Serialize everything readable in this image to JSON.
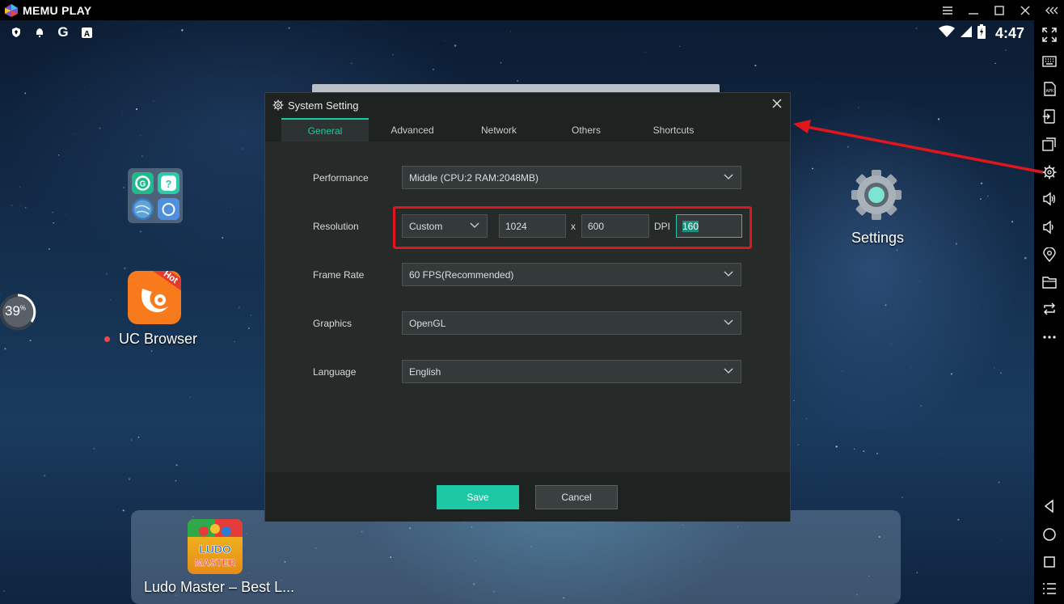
{
  "app": {
    "name": "MEMU PLAY"
  },
  "status_bar": {
    "time": "4:47"
  },
  "desktop": {
    "progress_value": "39",
    "progress_unit": "%",
    "apps": [
      {
        "label": "UC Browser",
        "badge": "Hot"
      },
      {
        "label": "Settings"
      },
      {
        "label": "Ludo Master – Best L..."
      }
    ],
    "ludo_icon_text": [
      "LUDO",
      "MASTER"
    ]
  },
  "dialog": {
    "title": "System Setting",
    "tabs": [
      "General",
      "Advanced",
      "Network",
      "Others",
      "Shortcuts"
    ],
    "active_tab": "General",
    "rows": {
      "performance": {
        "label": "Performance",
        "value": "Middle (CPU:2 RAM:2048MB)"
      },
      "resolution": {
        "label": "Resolution",
        "preset": "Custom",
        "width": "1024",
        "separator": "x",
        "height": "600",
        "dpi_label": "DPI",
        "dpi": "160"
      },
      "frame_rate": {
        "label": "Frame Rate",
        "value": "60 FPS(Recommended)"
      },
      "graphics": {
        "label": "Graphics",
        "value": "OpenGL"
      },
      "language": {
        "label": "Language",
        "value": "English"
      }
    },
    "buttons": {
      "save": "Save",
      "cancel": "Cancel"
    }
  },
  "colors": {
    "accent": "#1dc9a4",
    "highlight_red": "#e1161d",
    "dialog_bg": "#262b2a"
  }
}
